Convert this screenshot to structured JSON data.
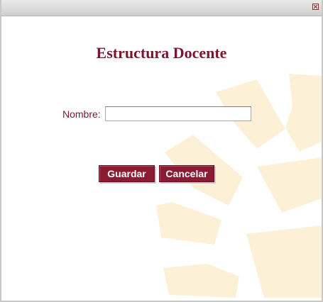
{
  "window": {
    "close_icon": "close-icon"
  },
  "form": {
    "title": "Estructura Docente",
    "name_label": "Nombre:",
    "name_value": "",
    "name_placeholder": ""
  },
  "actions": {
    "save_label": "Guardar",
    "cancel_label": "Cancelar"
  },
  "colors": {
    "accent": "#7a1630",
    "button_bg": "#8b1a33",
    "watermark": "#fcf1d6"
  }
}
